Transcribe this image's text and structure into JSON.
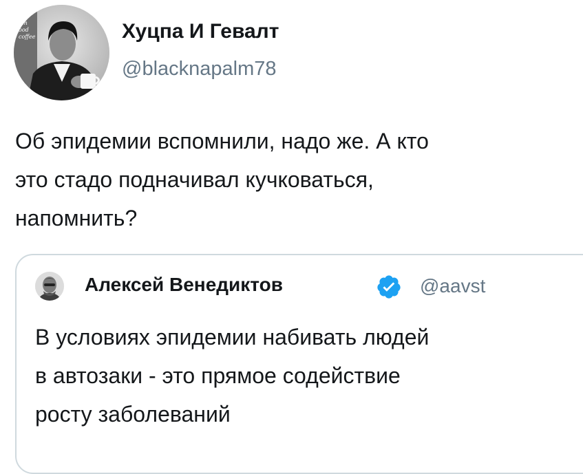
{
  "tweet": {
    "author": {
      "name": "Хуцпа И Гевалт",
      "handle": "@blacknapalm78",
      "avatar": {
        "icon": "person-drinking-coffee-avatar",
        "caption_lines": [
          "mn",
          "ood",
          "coffee"
        ]
      }
    },
    "text_lines": [
      "Об эпидемии вспомнили, надо же. А кто",
      "это стадо подначивал кучковаться,",
      "напомнить?"
    ],
    "quoted": {
      "author": {
        "name": "Алексей Венедиктов",
        "handle": "@aavst",
        "verified": true,
        "avatar_icon": "portrait-avatar"
      },
      "text_lines": [
        "В условиях эпидемии набивать людей",
        "в автозаки - это прямое содействие",
        "росту заболеваний"
      ]
    }
  },
  "colors": {
    "text": "#14171a",
    "secondary_text": "#657786",
    "verified": "#1da1f2",
    "card_border": "#cfd9de"
  }
}
